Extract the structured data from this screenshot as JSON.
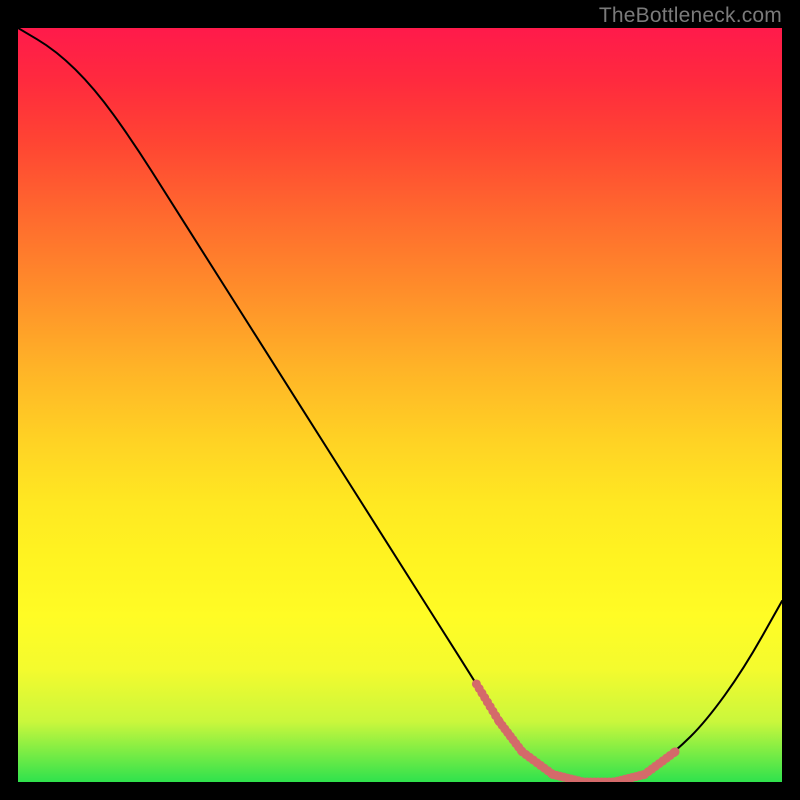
{
  "watermark": "TheBottleneck.com",
  "colors": {
    "background": "#000000",
    "curve": "#000000",
    "points": "#d46a6a",
    "watermark": "#7a7a7a"
  },
  "chart_data": {
    "type": "line",
    "title": "",
    "xlabel": "",
    "ylabel": "",
    "xlim": [
      0,
      100
    ],
    "ylim": [
      0,
      100
    ],
    "grid": false,
    "series": [
      {
        "name": "bottleneck-curve",
        "x": [
          0,
          5,
          10,
          15,
          20,
          25,
          30,
          35,
          40,
          45,
          50,
          55,
          60,
          63,
          66,
          70,
          74,
          78,
          82,
          86,
          90,
          95,
          100
        ],
        "y": [
          100,
          97,
          92,
          85,
          77,
          69,
          61,
          53,
          45,
          37,
          29,
          21,
          13,
          8,
          4,
          1,
          0,
          0,
          1,
          4,
          8,
          15,
          24
        ]
      }
    ],
    "highlight_band": {
      "x": [
        60,
        63,
        66,
        70,
        74,
        78,
        82,
        86
      ],
      "y": [
        13,
        8,
        4,
        1,
        0,
        0,
        1,
        4
      ],
      "note": "segment near minimum drawn with marker dots"
    }
  }
}
